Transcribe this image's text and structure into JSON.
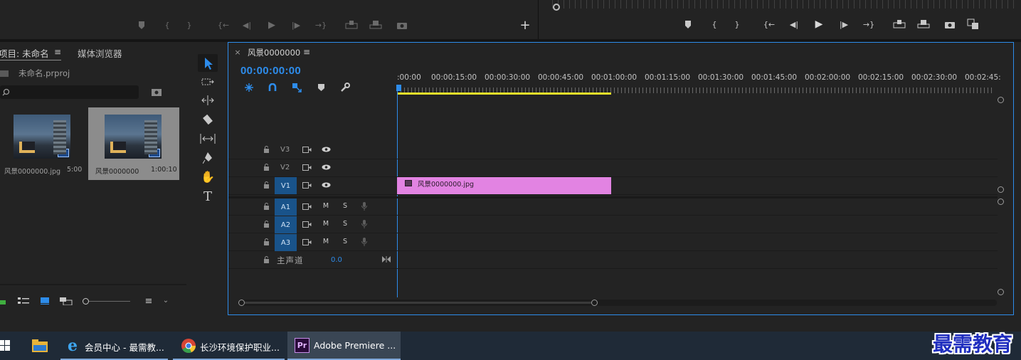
{
  "source_monitor": {
    "add_label": "+"
  },
  "project": {
    "tab_project": "项目: 未命名",
    "tab_media": "媒体浏览器",
    "file_name": "未命名.prproj",
    "search_placeholder": "",
    "items": [
      {
        "name": "风景0000000.jpg",
        "duration": "5:00"
      },
      {
        "name": "风景0000000",
        "duration": "1:00:10"
      }
    ]
  },
  "timeline": {
    "sequence_name": "风景0000000",
    "close_label": "×",
    "timecode": "00:00:00:00",
    "ruler_ticks": [
      ":00:00",
      "00:00:15:00",
      "00:00:30:00",
      "00:00:45:00",
      "00:01:00:00",
      "00:01:15:00",
      "00:01:30:00",
      "00:01:45:00",
      "00:02:00:00",
      "00:02:15:00",
      "00:02:30:00",
      "00:02:45:"
    ],
    "video_tracks": [
      "V3",
      "V2",
      "V1"
    ],
    "audio_tracks": [
      "A1",
      "A2",
      "A3"
    ],
    "mute_label": "M",
    "solo_label": "S",
    "master_label": "主声道",
    "master_value": "0.0",
    "clip_name": "风景0000000.jpg",
    "clip_color": "#e283e2",
    "work_area_color": "#e8e02a",
    "accent_color": "#2d8ceb"
  },
  "taskbar": {
    "items": [
      {
        "label": "会员中心 - 最需教..."
      },
      {
        "label": "长沙环境保护职业..."
      },
      {
        "label": "Adobe Premiere ..."
      }
    ],
    "pr_icon": "Pr",
    "watermark": "最需教育"
  }
}
